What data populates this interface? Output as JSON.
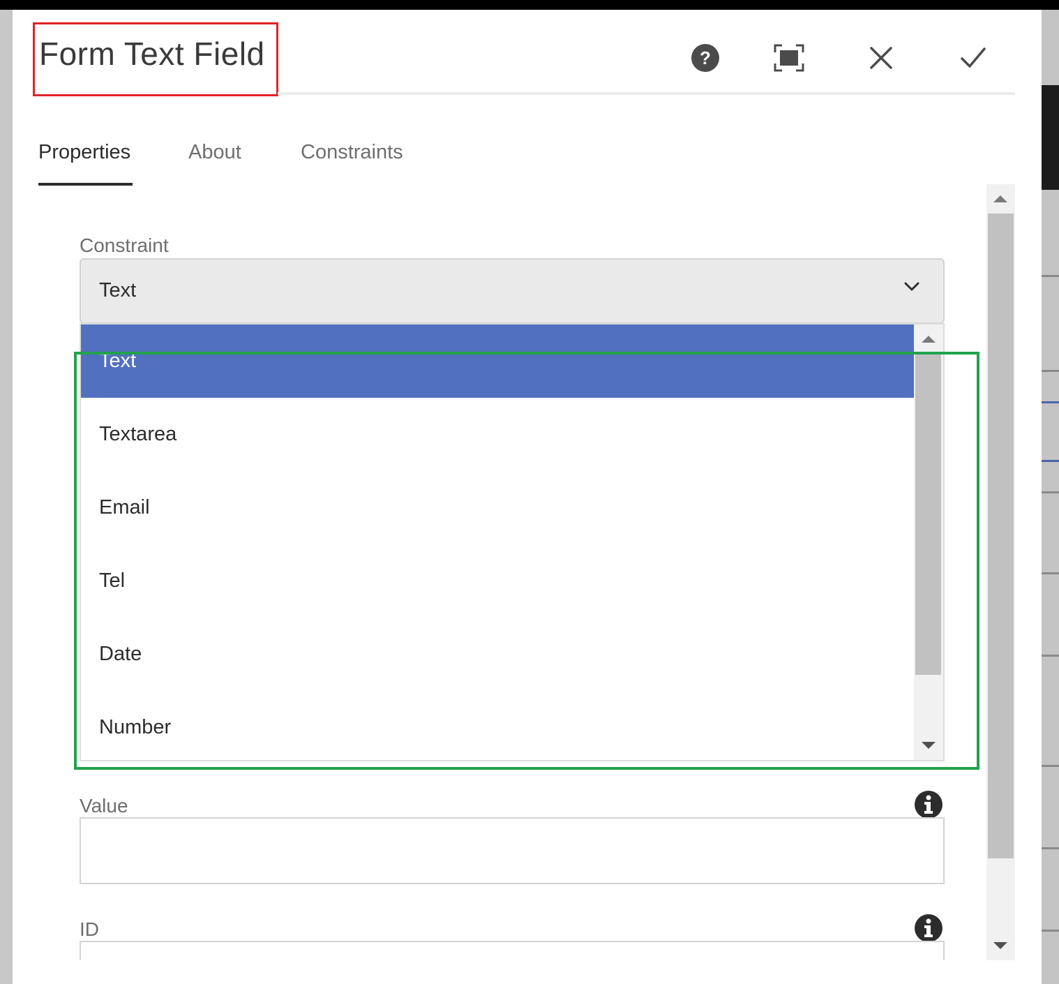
{
  "dialog": {
    "title": "Form Text Field",
    "header_buttons": [
      {
        "name": "help-button",
        "icon": "help-circle-icon"
      },
      {
        "name": "fullscreen-button",
        "icon": "fullscreen-icon"
      },
      {
        "name": "close-button",
        "icon": "close-icon"
      },
      {
        "name": "done-button",
        "icon": "checkmark-icon"
      }
    ]
  },
  "tabs": [
    {
      "label": "Properties",
      "active": true
    },
    {
      "label": "About",
      "active": false
    },
    {
      "label": "Constraints",
      "active": false
    }
  ],
  "constraint": {
    "label": "Constraint",
    "selected_value": "Text",
    "options": [
      "Text",
      "Textarea",
      "Email",
      "Tel",
      "Date",
      "Number"
    ]
  },
  "value_field": {
    "label": "Value",
    "value": ""
  },
  "id_field": {
    "label": "ID",
    "value": ""
  },
  "colors": {
    "selected_option": "#5170bf",
    "title_highlight": "#e32227",
    "list_highlight": "#22a24b"
  }
}
